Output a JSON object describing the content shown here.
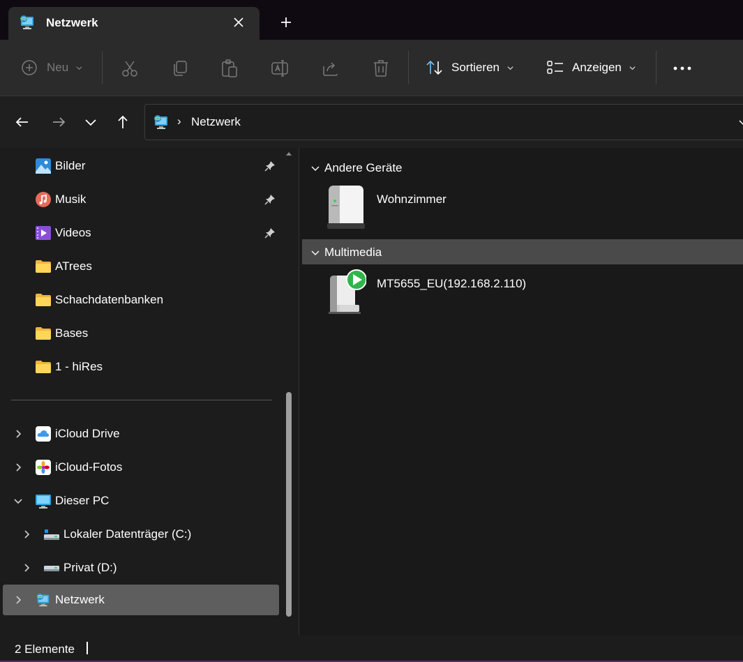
{
  "tab": {
    "title": "Netzwerk",
    "icon": "network-icon",
    "close_icon": "close-icon",
    "new_tab_icon": "plus-icon"
  },
  "commandbar": {
    "new_label": "Neu",
    "sort_label": "Sortieren",
    "view_label": "Anzeigen",
    "icons": [
      "cut-icon",
      "copy-icon",
      "paste-icon",
      "rename-icon",
      "share-icon",
      "delete-icon"
    ],
    "more_icon": "more-icon"
  },
  "address": {
    "separator": "›",
    "path": "Netzwerk"
  },
  "sidebar": {
    "pinned": [
      {
        "label": "Bilder",
        "icon": "pictures-icon",
        "pinned": true
      },
      {
        "label": "Musik",
        "icon": "music-icon",
        "pinned": true
      },
      {
        "label": "Videos",
        "icon": "videos-icon",
        "pinned": true
      },
      {
        "label": "ATrees",
        "icon": "folder-icon",
        "pinned": false
      },
      {
        "label": "Schachdatenbanken",
        "icon": "folder-icon",
        "pinned": false
      },
      {
        "label": "Bases",
        "icon": "folder-icon",
        "pinned": false
      },
      {
        "label": "1 - hiRes",
        "icon": "folder-icon",
        "pinned": false
      }
    ],
    "tree": [
      {
        "label": "iCloud Drive",
        "icon": "icloud-drive-icon",
        "expanded": false
      },
      {
        "label": "iCloud-Fotos",
        "icon": "icloud-photos-icon",
        "expanded": false
      },
      {
        "label": "Dieser PC",
        "icon": "this-pc-icon",
        "expanded": true
      },
      {
        "label": "Lokaler Datenträger (C:)",
        "icon": "drive-c-icon",
        "expanded": false
      },
      {
        "label": "Privat (D:)",
        "icon": "drive-d-icon",
        "expanded": false
      },
      {
        "label": "Netzwerk",
        "icon": "network-icon",
        "expanded": false,
        "selected": true
      }
    ]
  },
  "content": {
    "groups": [
      {
        "title": "Andere Geräte",
        "items": [
          {
            "name": "Wohnzimmer",
            "icon": "computer-device-icon"
          }
        ]
      },
      {
        "title": "Multimedia",
        "items": [
          {
            "name": "MT5655_EU(192.168.2.110)",
            "icon": "media-device-icon"
          }
        ]
      }
    ]
  },
  "status": {
    "count_text": "2 Elemente"
  },
  "colors": {
    "accent_border": "#5b2a66",
    "selection": "#5e5e5e"
  }
}
